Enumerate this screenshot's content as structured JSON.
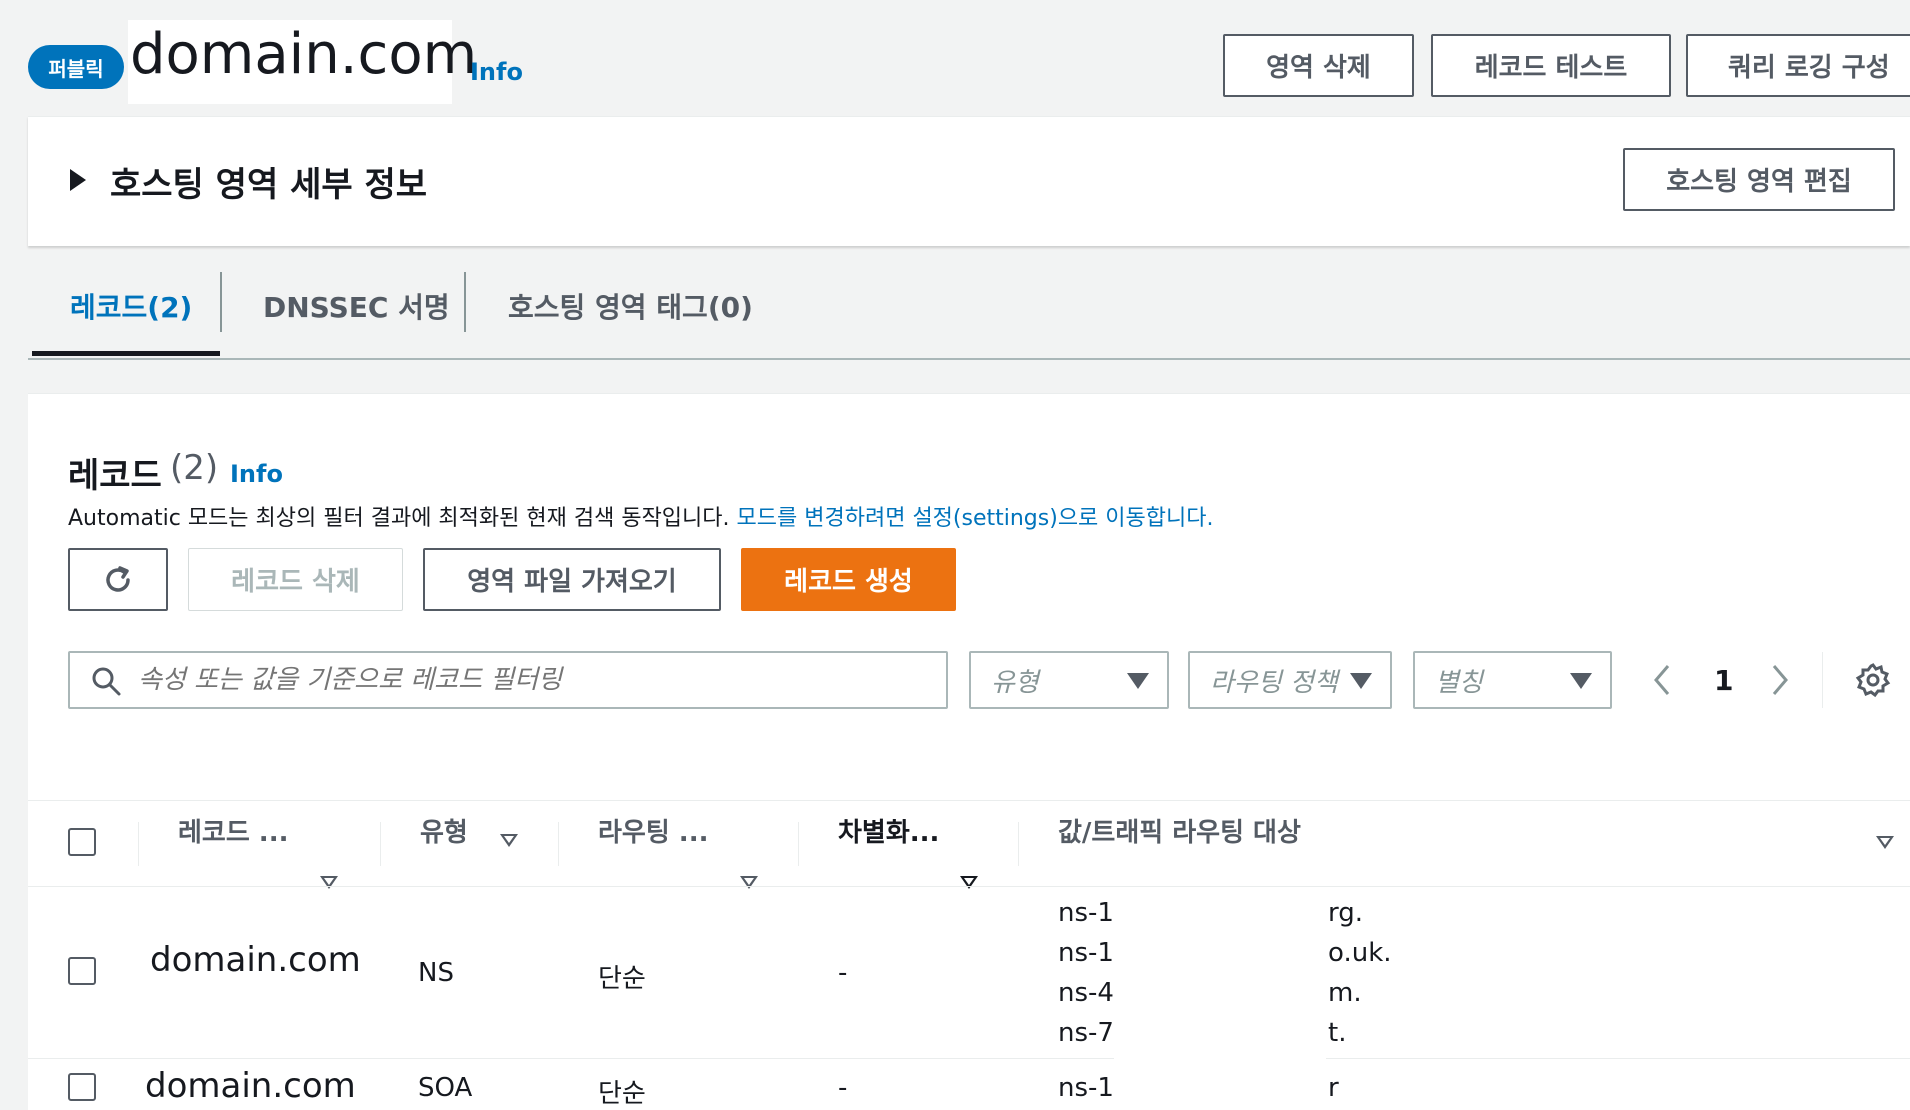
{
  "header": {
    "badge": "퍼블릭",
    "domain": "domain.com",
    "info": "Info",
    "buttons": {
      "delete_zone": "영역 삭제",
      "test_record": "레코드 테스트",
      "query_logging": "쿼리 로깅 구성"
    }
  },
  "details": {
    "title": "호스팅 영역 세부 정보",
    "edit_button": "호스팅 영역 편집"
  },
  "tabs": [
    {
      "label": "레코드(2)",
      "active": true
    },
    {
      "label": "DNSSEC 서명",
      "active": false
    },
    {
      "label": "호스팅 영역 태그(0)",
      "active": false
    }
  ],
  "records": {
    "title": "레코드",
    "count": "(2)",
    "info": "Info",
    "description": "Automatic 모드는 최상의 필터 결과에 최적화된 현재 검색 동작입니다.",
    "description_link": "모드를 변경하려면 설정(settings)으로 이동합니다.",
    "delete_button": "레코드 삭제",
    "import_button": "영역 파일 가져오기",
    "create_button": "레코드 생성",
    "search_placeholder": "속성 또는 값을 기준으로 레코드 필터링",
    "filters": {
      "type": "유형",
      "routing": "라우팅 정책",
      "alias": "별칭"
    },
    "page": "1"
  },
  "table": {
    "columns": [
      "레코드 ...",
      "유형",
      "라우팅 ...",
      "차별화...",
      "값/트래픽 라우팅 대상"
    ],
    "rows": [
      {
        "name": "domain.com",
        "type": "NS",
        "routing": "단순",
        "diff": "-",
        "values": [
          {
            "prefix": "ns-1",
            "suffix": "rg."
          },
          {
            "prefix": "ns-1",
            "suffix": "o.uk."
          },
          {
            "prefix": "ns-4",
            "suffix": "m."
          },
          {
            "prefix": "ns-7",
            "suffix": "t."
          }
        ]
      },
      {
        "name": "domain.com",
        "type": "SOA",
        "routing": "단순",
        "diff": "-",
        "values": [
          {
            "prefix": "ns-1",
            "suffix": "r"
          }
        ]
      }
    ]
  }
}
